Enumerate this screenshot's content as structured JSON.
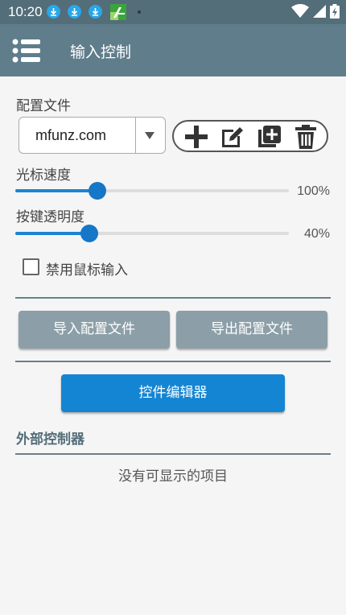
{
  "status_bar": {
    "time": "10:20",
    "notification_icons": [
      "download-icon",
      "download-icon",
      "download-icon",
      "app-icon"
    ],
    "system_icons": [
      "wifi-icon",
      "cell-signal-icon",
      "battery-charging-icon"
    ]
  },
  "toolbar": {
    "title": "输入控制",
    "menu_icon": "menu-icon"
  },
  "config": {
    "label": "配置文件",
    "selected": "mfunz.com",
    "actions": [
      "add-icon",
      "edit-icon",
      "duplicate-icon",
      "delete-icon"
    ]
  },
  "cursor_speed": {
    "label": "光标速度",
    "value_text": "100%",
    "fraction": 0.3
  },
  "key_opacity": {
    "label": "按键透明度",
    "value_text": "40%",
    "fraction": 0.27
  },
  "disable_mouse": {
    "label": "禁用鼠标输入",
    "checked": false
  },
  "buttons": {
    "import": "导入配置文件",
    "export": "导出配置文件",
    "editor": "控件编辑器"
  },
  "external": {
    "title": "外部控制器",
    "empty": "没有可显示的项目"
  },
  "colors": {
    "status_bar": "#536d79",
    "toolbar": "#607d8b",
    "accent": "#1485d3",
    "gray_button": "#8c9fa8"
  }
}
